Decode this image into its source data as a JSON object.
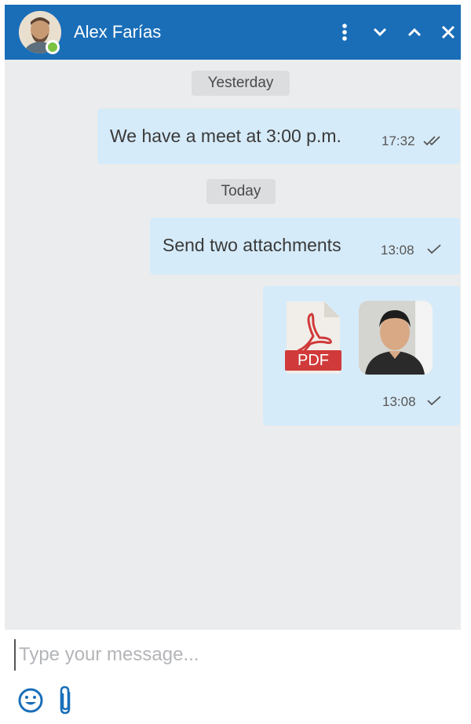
{
  "header": {
    "contact_name": "Alex Farías",
    "status": "online",
    "icons": [
      "more-vert-icon",
      "chevron-down-icon",
      "chevron-up-icon",
      "close-icon"
    ]
  },
  "conversation": {
    "separators": [
      "Yesterday",
      "Today"
    ],
    "messages": [
      {
        "text": "We have a meet at 3:00 p.m.",
        "time": "17:32",
        "status": "read"
      },
      {
        "text": "Send two attachments",
        "time": "13:08",
        "status": "sent"
      },
      {
        "attachments": [
          {
            "type": "pdf",
            "label": "PDF"
          },
          {
            "type": "image"
          }
        ],
        "time": "13:08",
        "status": "sent"
      }
    ]
  },
  "composer": {
    "placeholder": "Type your message...",
    "value": ""
  },
  "colors": {
    "header_bg": "#1a6eb8",
    "chat_bg": "#ebeced",
    "bubble_bg": "#d6ebf9",
    "online": "#7cc242",
    "pdf_red": "#d13a3a",
    "icon_blue": "#1a6eb8"
  }
}
